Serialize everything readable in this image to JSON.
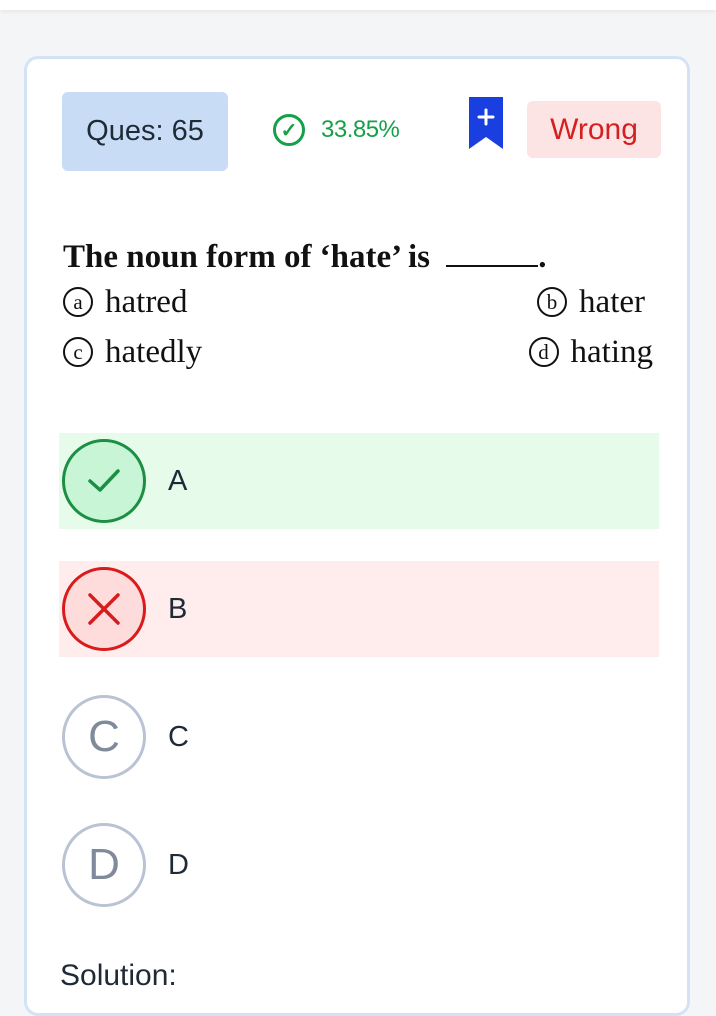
{
  "header": {
    "question_label": "Ques: 65",
    "accuracy": "33.85%",
    "status": "Wrong",
    "bookmark_icon": "bookmark-plus-icon",
    "check_icon_glyph": "✓"
  },
  "question": {
    "text": "The noun form of ‘hate’ is",
    "end_punct": ".",
    "options": [
      {
        "marker": "a",
        "text": "hatred"
      },
      {
        "marker": "b",
        "text": "hater"
      },
      {
        "marker": "c",
        "text": "hatedly"
      },
      {
        "marker": "d",
        "text": "hating"
      }
    ]
  },
  "choices": [
    {
      "letter": "A",
      "state": "correct",
      "icon": "check-icon"
    },
    {
      "letter": "B",
      "state": "wrong",
      "icon": "cross-icon"
    },
    {
      "letter": "C",
      "state": "neutral",
      "icon_glyph": "C"
    },
    {
      "letter": "D",
      "state": "neutral",
      "icon_glyph": "D"
    }
  ],
  "solution_label": "Solution:",
  "colors": {
    "correct": "#15a04a",
    "wrong": "#d61f1f",
    "accent": "#1a3fe0",
    "question_badge": "#c9dcf6"
  }
}
